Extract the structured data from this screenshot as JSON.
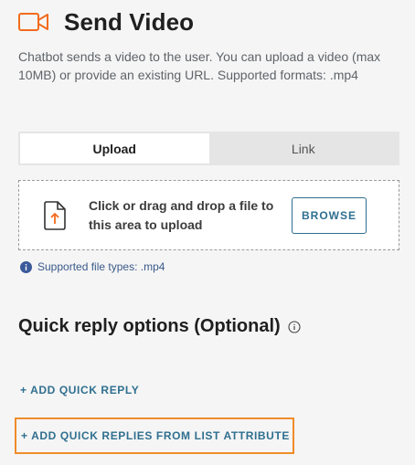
{
  "header": {
    "title": "Send Video",
    "icon": "video-camera-icon",
    "accent_color": "#f26b1d"
  },
  "description": "Chatbot sends a video to the user. You can upload a video (max 10MB) or provide an existing URL. Supported formats: .mp4",
  "tabs": [
    {
      "label": "Upload",
      "active": true
    },
    {
      "label": "Link",
      "active": false
    }
  ],
  "dropzone": {
    "text": "Click or drag and drop a file to this area to upload",
    "icon": "file-upload-icon",
    "browse_label": "BROWSE"
  },
  "hint": {
    "icon": "info-icon",
    "text": "Supported file types: .mp4"
  },
  "quick_replies": {
    "title": "Quick reply options (Optional)",
    "help_icon": "help-circle-icon",
    "add_label": "+ ADD QUICK REPLY",
    "add_from_list_label": "+ ADD QUICK REPLIES FROM LIST ATTRIBUTE"
  }
}
